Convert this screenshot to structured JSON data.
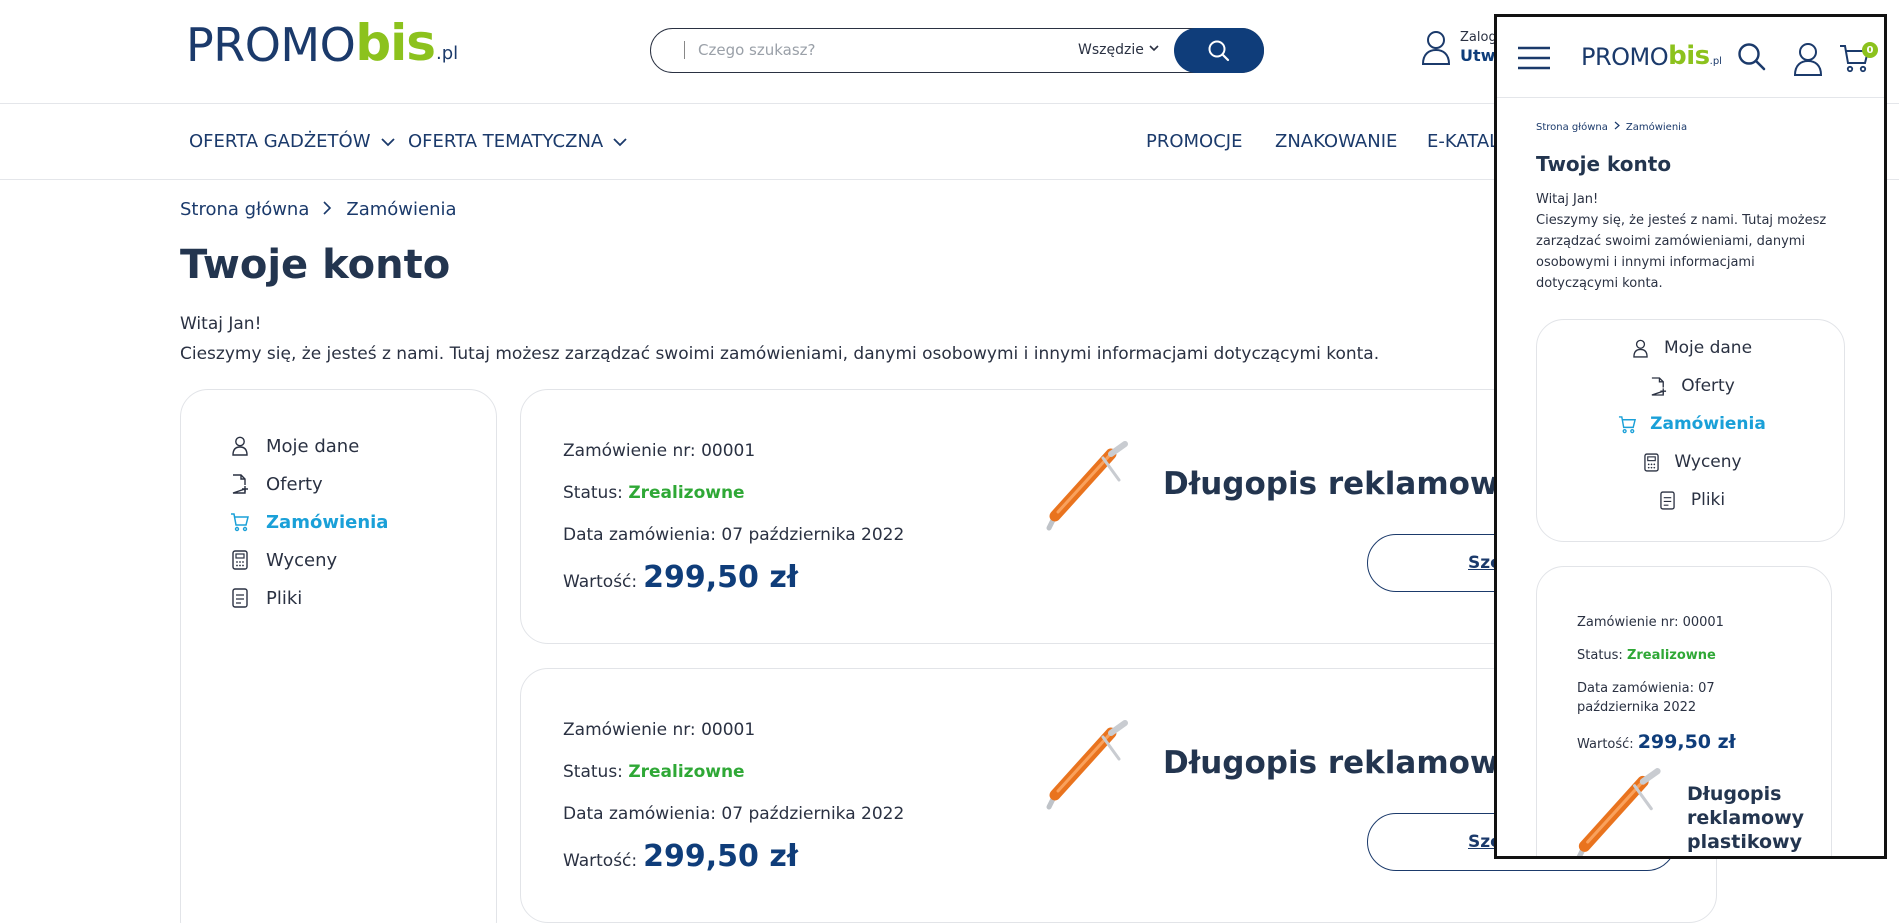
{
  "header": {
    "logo": {
      "promo": "PROMO",
      "bis": "bis",
      "pl": ".pl"
    },
    "search": {
      "placeholder": "Czego szukasz?",
      "scope": "Wszędzie"
    },
    "account": {
      "line1": "Zalog",
      "line2": "Utw"
    }
  },
  "nav": {
    "left": [
      "OFERTA GADŻETÓW",
      "OFERTA TEMATYCZNA"
    ],
    "right": [
      "PROMOCJE",
      "ZNAKOWANIE",
      "E-KATAL"
    ]
  },
  "breadcrumb": [
    "Strona główna",
    "Zamówienia"
  ],
  "page_title": "Twoje konto",
  "greeting": {
    "line1": "Witaj Jan!",
    "line2": "Cieszymy się, że jesteś z nami. Tutaj możesz zarządzać swoimi zamówieniami, danymi osobowymi i innymi informacjami dotyczącymi konta."
  },
  "menu": [
    {
      "label": "Moje dane",
      "icon": "user-icon",
      "active": false
    },
    {
      "label": "Oferty",
      "icon": "document-plus-icon",
      "active": false
    },
    {
      "label": "Zamówienia",
      "icon": "cart-icon",
      "active": true
    },
    {
      "label": "Wyceny",
      "icon": "calculator-icon",
      "active": false
    },
    {
      "label": "Pliki",
      "icon": "file-icon",
      "active": false
    }
  ],
  "orders": [
    {
      "number_label": "Zamówienie nr: 00001",
      "status_label": "Status: ",
      "status_value": "Zrealizowne",
      "date_label": "Data zamówienia: 07 października 2022",
      "value_label": "Wartość:",
      "value_amount": "299,50 zł",
      "product": "Długopis reklamowy",
      "button": "Szc"
    },
    {
      "number_label": "Zamówienie nr: 00001",
      "status_label": "Status: ",
      "status_value": "Zrealizowne",
      "date_label": "Data zamówienia: 07 października 2022",
      "value_label": "Wartość:",
      "value_amount": "299,50 zł",
      "product": "Długopis reklamowy",
      "button": "Szc"
    }
  ],
  "mobile": {
    "cart_count": "0",
    "breadcrumb": [
      "Strona główna",
      "Zamówienia"
    ],
    "title": "Twoje konto",
    "greet_line1": "Witaj Jan!",
    "greet_line2": "Cieszymy się, że jesteś z nami. Tutaj możesz zarządzać swoimi zamówieniami, danymi osobowymi i innymi informacjami dotyczącymi konta.",
    "order": {
      "number_label": "Zamówienie nr: 00001",
      "status_label": "Status: ",
      "status_value": "Zrealizowne",
      "date_label": "Data zamówienia: 07 października 2022",
      "value_label": "Wartość:",
      "value_amount": "299,50 zł",
      "product": "Długopis reklamowy plastikowy"
    }
  },
  "colors": {
    "brand_navy": "#0f3d7a",
    "brand_green": "#8cc21d",
    "active_blue": "#1aa0d8",
    "status_green": "#2fa836"
  }
}
